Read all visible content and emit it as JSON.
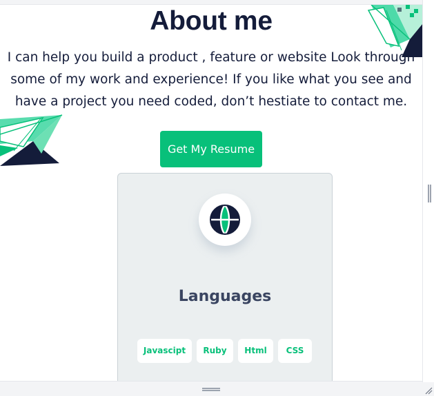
{
  "section": {
    "title": "About me",
    "intro_lines": [
      "I can help you build a product , feature or website Look through",
      "some of my work and experience! If you like what you see and",
      "have a project you need coded, don’t hestiate to contact me."
    ],
    "resume_button_label": "Get My Resume"
  },
  "skill_card": {
    "icon": "globe-icon",
    "title": "Languages",
    "tags": [
      "Javascipt",
      "Ruby",
      "Html",
      "CSS"
    ]
  },
  "colors": {
    "heading": "#141c3a",
    "accent_green": "#08c07a",
    "card_background": "#ebeff0",
    "card_title": "#3a4561"
  },
  "decorations": [
    "geometric-shape-top-right",
    "geometric-shape-left"
  ]
}
